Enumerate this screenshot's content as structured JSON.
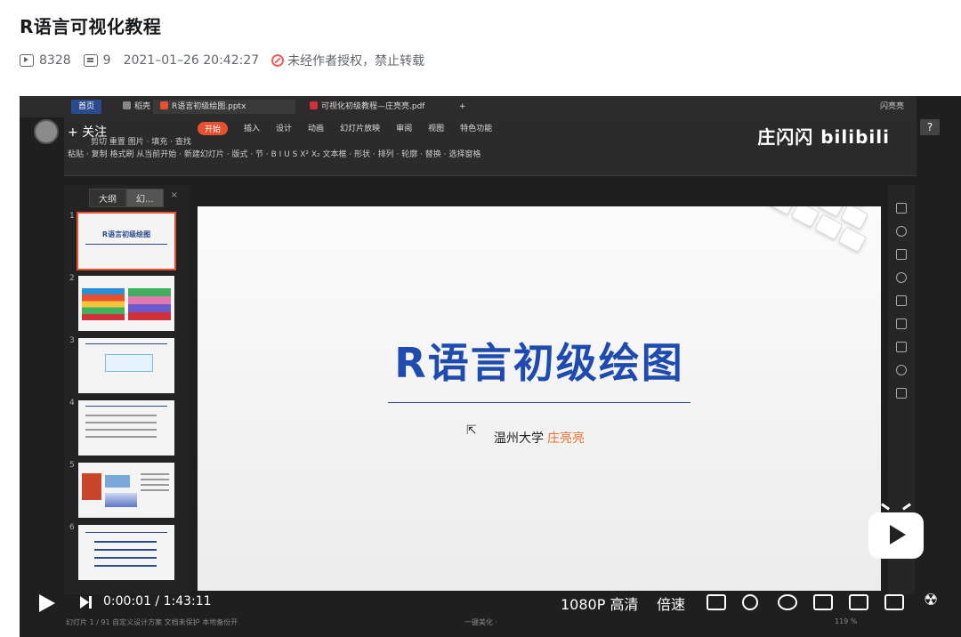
{
  "header": {
    "title": "R语言可视化教程",
    "views": "8328",
    "danmaku": "9",
    "datetime": "2021–01–26 20:42:27",
    "notice": "未经作者授权，禁止转载"
  },
  "app_tabs": {
    "home": "首页",
    "wps": "稻壳",
    "pptx": "R语言初级绘图.pptx",
    "pdf": "可视化初级教程—庄亮亮.pdf",
    "add": "+",
    "user": "闪亮亮"
  },
  "uploader": {
    "follow_label": "+ 关注",
    "watermark": "庄闪闪 bilibili"
  },
  "ribbon": {
    "menu": [
      "开始",
      "插入",
      "设计",
      "动画",
      "幻灯片放映",
      "审阅",
      "视图",
      "特色功能"
    ],
    "row": "粘贴 ·  复制  格式刷    从当前开始 ·   新建幻灯片 ·   版式 ·   节 ·   B  I  U  S  X²  X₂       文本框 ·  形状 ·  排列 ·  轮廓 ·   替换 ·   选择窗格",
    "row_top": "剪切           重置                                             图片 ·  填充 ·   查找"
  },
  "thumbnails": {
    "tab_outline": "大纲",
    "tab_slides": "幻...",
    "close": "×",
    "items": [
      {
        "num": "1",
        "title": "R语言初级绘图"
      },
      {
        "num": "2",
        "title": ""
      },
      {
        "num": "3",
        "title": ""
      },
      {
        "num": "4",
        "title": ""
      },
      {
        "num": "5",
        "title": ""
      },
      {
        "num": "6",
        "title": ""
      }
    ]
  },
  "slide": {
    "title": "R语言初级绘图",
    "subtitle_org": "温州大学",
    "subtitle_name": "庄亮亮"
  },
  "statusbar": {
    "left": "幻灯片 1 / 91     自定义设计方案    文档未保护    本地备份开",
    "center": "一键美化 ·",
    "zoom": "119 %"
  },
  "player": {
    "time": "0:00:01 / 1:43:11",
    "quality": "1080P 高清",
    "speed": "倍速",
    "help": "?"
  },
  "colors": {
    "accent": "#e9502f",
    "slide_title": "#1f4bb0",
    "name_orange": "#e9702f"
  }
}
